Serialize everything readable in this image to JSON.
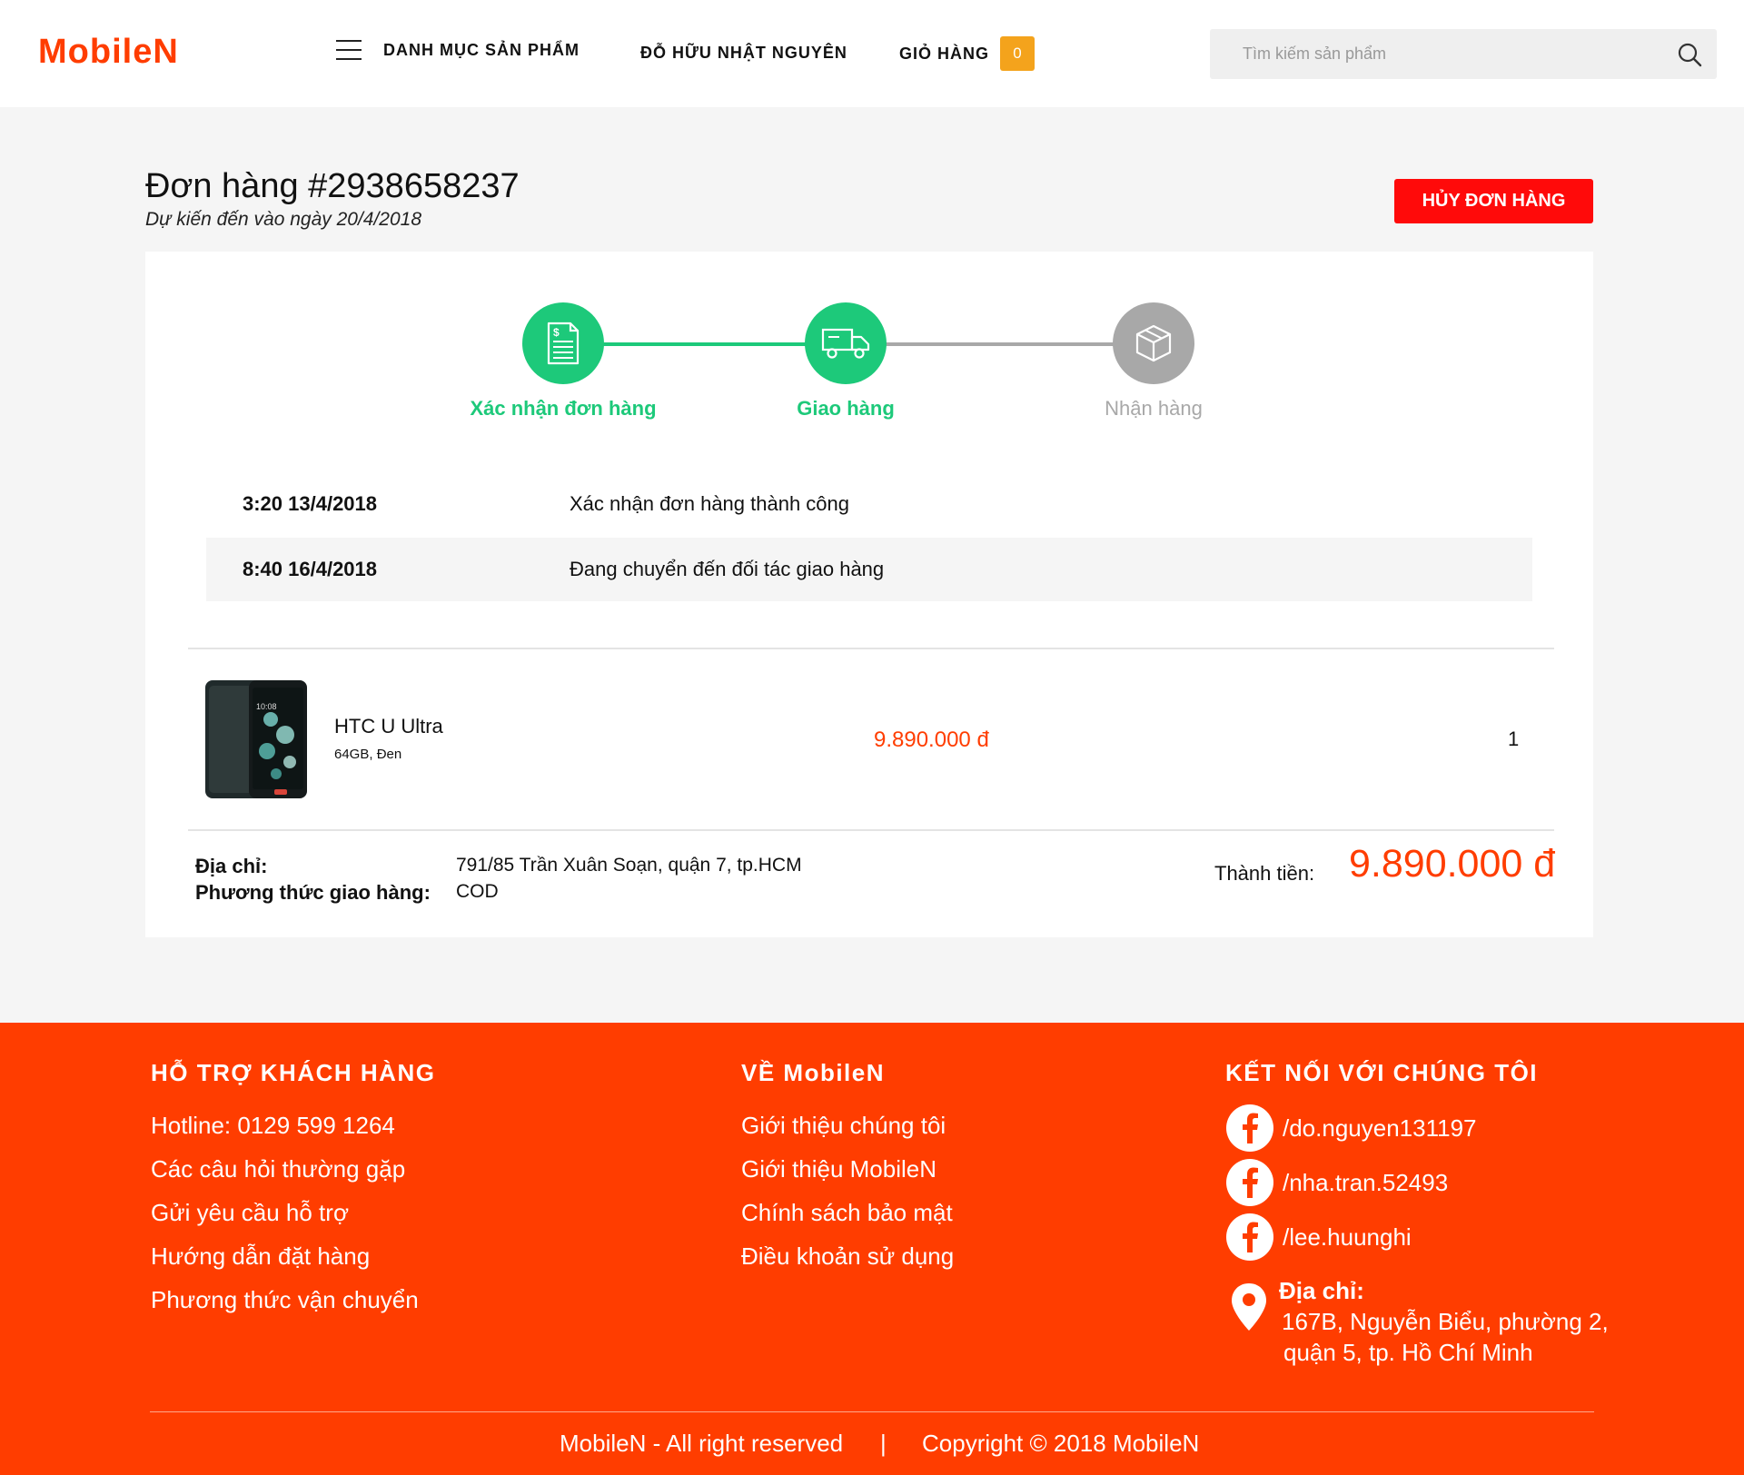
{
  "header": {
    "logo": "MobileN",
    "menu_label": "DANH MỤC SẢN PHẨM",
    "user_name": "ĐỖ HỮU NHẬT NGUYÊN",
    "cart_label": "GIỎ HÀNG",
    "cart_count": "0",
    "search_placeholder": "Tìm kiếm sản phẩm"
  },
  "order": {
    "title": "Đơn hàng #2938658237",
    "eta": "Dự kiến đến vào ngày 20/4/2018",
    "cancel_label": "HỦY ĐƠN HÀNG",
    "steps": [
      {
        "label": "Xác nhận đơn hàng",
        "state": "done",
        "icon": "invoice-icon"
      },
      {
        "label": "Giao hàng",
        "state": "done",
        "icon": "truck-icon"
      },
      {
        "label": "Nhận hàng",
        "state": "pending",
        "icon": "box-icon"
      }
    ],
    "timeline": [
      {
        "time": "3:20 13/4/2018",
        "text": "Xác nhận đơn hàng thành công"
      },
      {
        "time": "8:40 16/4/2018",
        "text": "Đang chuyển đến đối tác giao hàng"
      }
    ],
    "item": {
      "name": "HTC U Ultra",
      "variant": "64GB, Đen",
      "price": "9.890.000 đ",
      "qty": "1"
    },
    "address_label": "Địa chỉ:",
    "address_value": "791/85 Trần Xuân Soạn, quận 7, tp.HCM",
    "shipping_label": "Phương thức giao hàng:",
    "shipping_value": "COD",
    "total_label": "Thành tiền:",
    "total_value": "9.890.000 đ"
  },
  "footer": {
    "support": {
      "heading": "HỖ TRỢ KHÁCH HÀNG",
      "links": [
        "Hotline: 0129 599 1264",
        "Các câu hỏi thường gặp",
        "Gửi yêu cầu hỗ trợ",
        "Hướng dẫn đặt hàng",
        "Phương thức vận chuyển"
      ]
    },
    "about": {
      "heading": "VỀ MobileN",
      "links": [
        "Giới thiệu chúng tôi",
        "Giới thiệu MobileN",
        "Chính sách bảo mật",
        "Điều khoản sử dụng"
      ]
    },
    "connect": {
      "heading": "KẾT NỐI VỚI CHÚNG TÔI",
      "facebook": [
        "/do.nguyen131197",
        "/nha.tran.52493",
        "/lee.huunghi"
      ],
      "address_label": "Địa chỉ:",
      "address_line1": "167B, Nguyễn Biểu, phường 2,",
      "address_line2": "quận 5, tp. Hồ Chí Minh"
    },
    "rights": "MobileN - All right reserved",
    "separator": "|",
    "copyright": "Copyright © 2018 MobileN"
  },
  "colors": {
    "brand": "#ff3d00",
    "success": "#1dc97a",
    "pending": "#a8a8a8",
    "cancel": "#ff0a0a",
    "badge": "#f4a31c"
  }
}
